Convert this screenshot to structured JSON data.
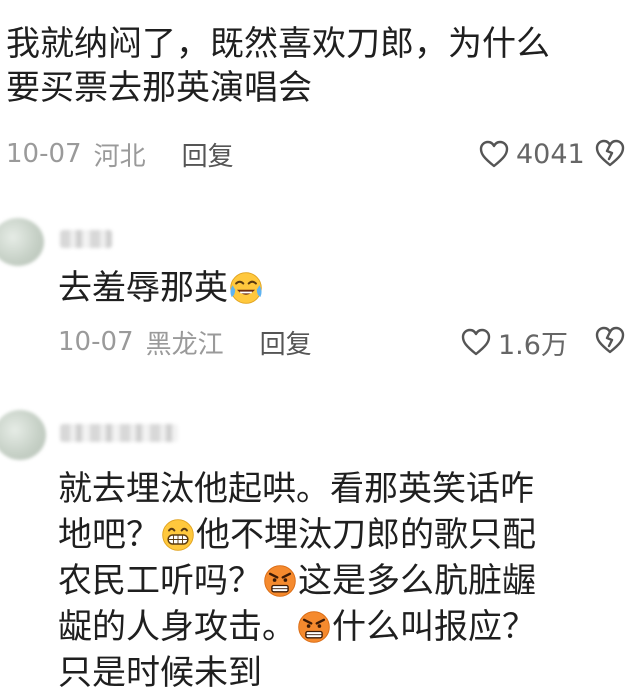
{
  "comments": [
    {
      "text_lines": [
        "我就纳闷了，既然喜欢刀郎，为什么",
        "要买票去那英演唱会"
      ],
      "date": "10-07",
      "location": "河北",
      "reply_label": "回复",
      "likes": "4041"
    },
    {
      "text": "去羞辱那英",
      "emoji": "crying-laughing-emoji",
      "date": "10-07",
      "location": "黑龙江",
      "reply_label": "回复",
      "likes": "1.6万"
    },
    {
      "segments": {
        "l1": "就去埋汰他起哄。看那英笑话咋",
        "l2a": "地吧？",
        "l2b": "他不埋汰刀郎的歌只配",
        "l3a": "农民工听吗？",
        "l3b": "这是多么肮脏龌",
        "l4a": "龊的人身攻击。",
        "l4b": "什么叫报应？",
        "l5": "只是时候未到"
      },
      "emojis": [
        "grinning-emoji",
        "angry-emoji",
        "angry-emoji"
      ]
    }
  ],
  "icons": [
    "heart-icon",
    "broken-heart-icon"
  ]
}
